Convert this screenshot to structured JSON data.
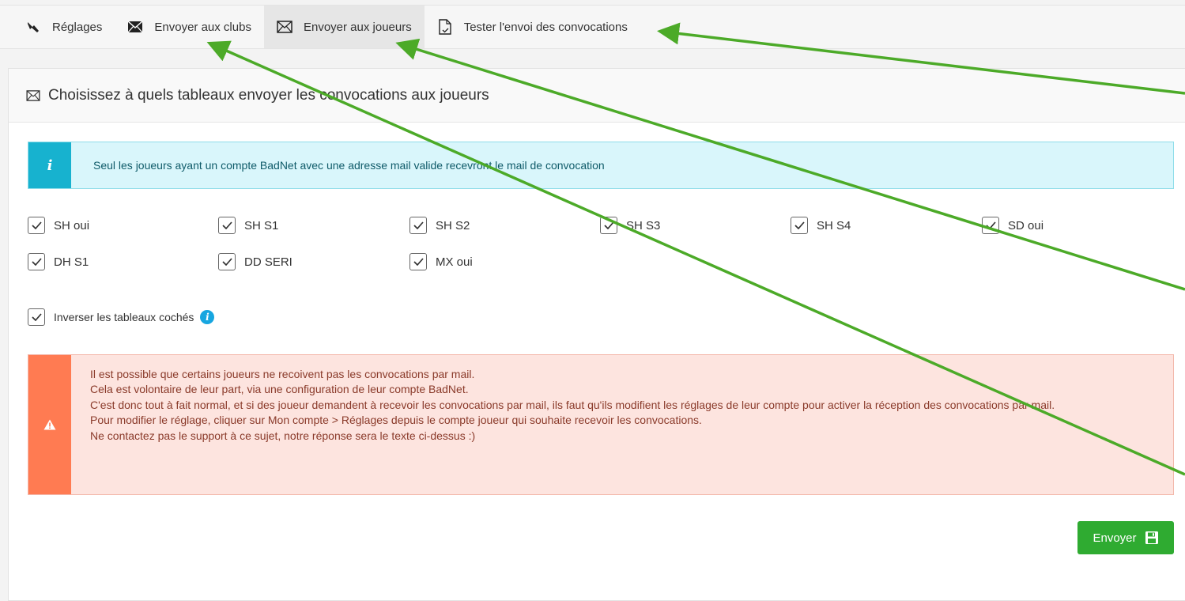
{
  "tabs": [
    {
      "label": "Réglages",
      "icon": "wrench-icon"
    },
    {
      "label": "Envoyer aux clubs",
      "icon": "envelope-filled-icon"
    },
    {
      "label": "Envoyer aux joueurs",
      "icon": "envelope-outline-icon",
      "active": true
    },
    {
      "label": "Tester l'envoi des convocations",
      "icon": "document-check-icon"
    }
  ],
  "panel": {
    "title": "Choisissez à quels tableaux envoyer les convocations aux joueurs",
    "title_icon": "envelope-outline-icon"
  },
  "info": {
    "icon": "info-icon",
    "badge": "i",
    "text": "Seul les joueurs ayant un compte BadNet avec une adresse mail valide recevront le mail de convocation"
  },
  "tableaux": [
    {
      "label": "SH oui",
      "checked": true
    },
    {
      "label": "SH S1",
      "checked": true
    },
    {
      "label": "SH S2",
      "checked": true
    },
    {
      "label": "SH S3",
      "checked": true
    },
    {
      "label": "SH S4",
      "checked": true
    },
    {
      "label": "SD oui",
      "checked": true
    },
    {
      "label": "DH S1",
      "checked": true
    },
    {
      "label": "DD SERI",
      "checked": true
    },
    {
      "label": "MX oui",
      "checked": true
    }
  ],
  "invert": {
    "label": "Inverser les tableaux cochés",
    "checked": true,
    "help_icon": "info-circle-icon",
    "help_glyph": "i"
  },
  "warning": {
    "icon": "warning-triangle-icon",
    "lines": [
      "Il est possible que certains joueurs ne recoivent pas les convocations par mail.",
      "Cela est volontaire de leur part, via une configuration de leur compte BadNet.",
      "C'est donc tout à fait normal, et si des joueur demandent à recevoir les convocations par mail, ils faut qu'ils modifient les réglages de leur compte pour activer la réception des convocations par mail.",
      "Pour modifier le réglage, cliquer sur Mon compte > Réglages depuis le compte joueur qui souhaite recevoir les convocations.",
      "Ne contactez pas le support à ce sujet, notre réponse sera le texte ci-dessus :)"
    ]
  },
  "send_button": {
    "label": "Envoyer",
    "icon": "save-icon"
  },
  "colors": {
    "accent_green": "#2fab31",
    "info_bg": "#d9f6fb",
    "info_badge": "#17b2cf",
    "warn_bg": "#fde4df",
    "warn_badge": "#ff7b52",
    "annotation_arrow": "#4caa28"
  }
}
